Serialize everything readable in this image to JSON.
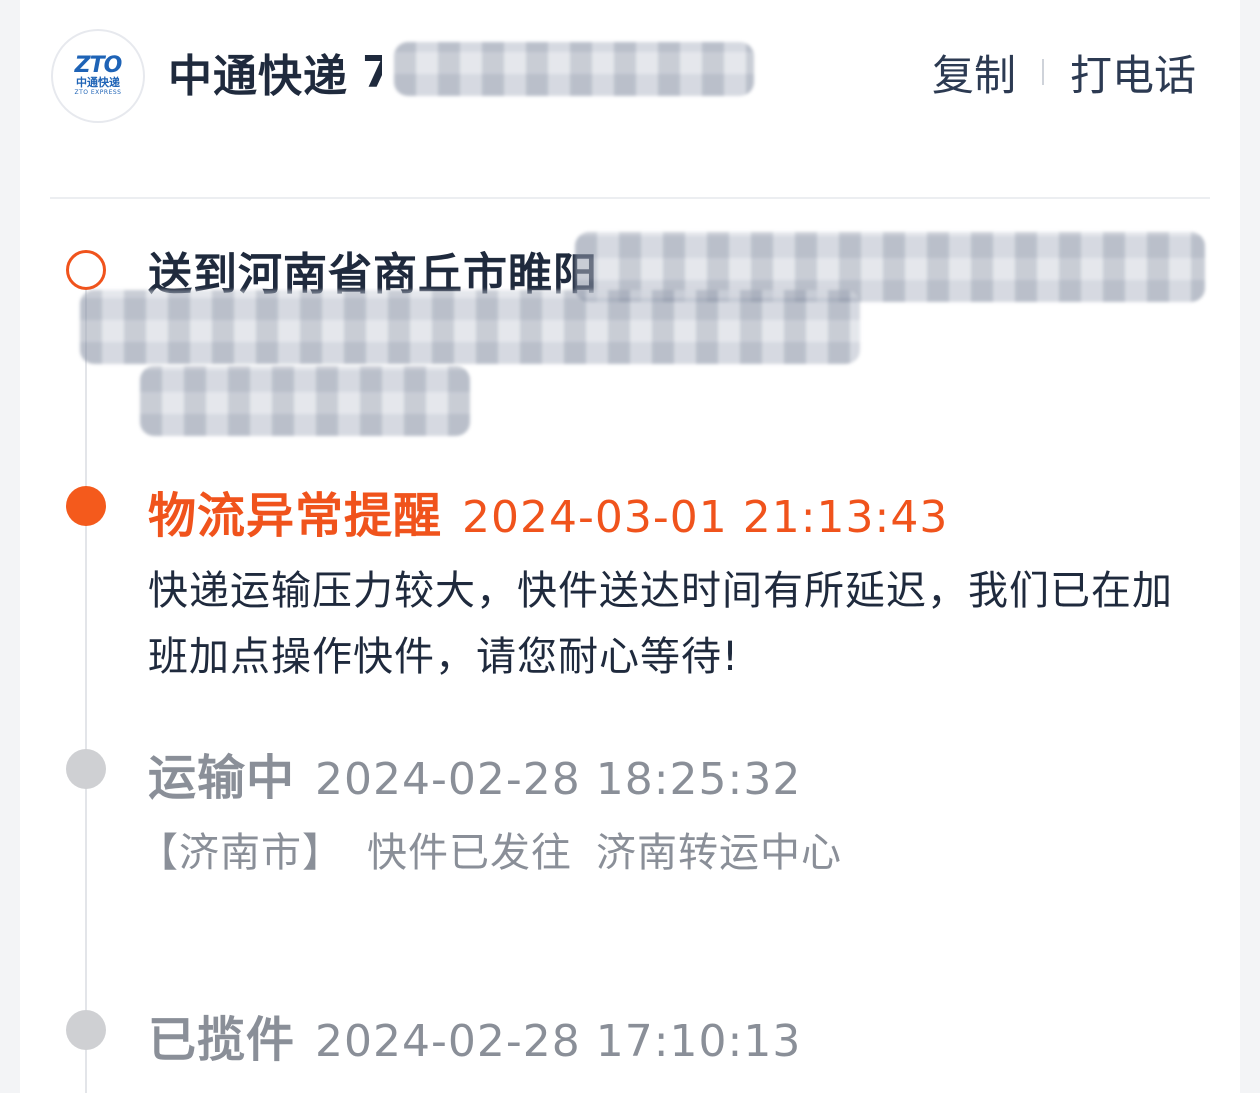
{
  "header": {
    "logo": {
      "mark": "ZTO",
      "cn": "中通快递",
      "en": "ZTO EXPRESS"
    },
    "carrier_name": "中通快递",
    "tracking_number_visible": "7",
    "actions": {
      "copy_label": "复制",
      "call_label": "打电话"
    }
  },
  "destination": {
    "prefix_text": "送到河南省商丘市睢阳"
  },
  "events": [
    {
      "status": "物流异常提醒",
      "time": "2024-03-01 21:13:43",
      "description": "快递运输压力较大，快件送达时间有所延迟，我们已在加班加点操作快件，请您耐心等待!",
      "state": "alert"
    },
    {
      "status": "运输中",
      "time": "2024-02-28 18:25:32",
      "city": "【济南市】",
      "description": "快件已发往",
      "target": "济南转运中心",
      "state": "past"
    },
    {
      "status": "已揽件",
      "time": "2024-02-28 17:10:13",
      "state": "past"
    }
  ],
  "colors": {
    "alert": "#f0531c",
    "past": "#8a8f98",
    "text": "#1f2a3d",
    "brand": "#1e63b6"
  }
}
